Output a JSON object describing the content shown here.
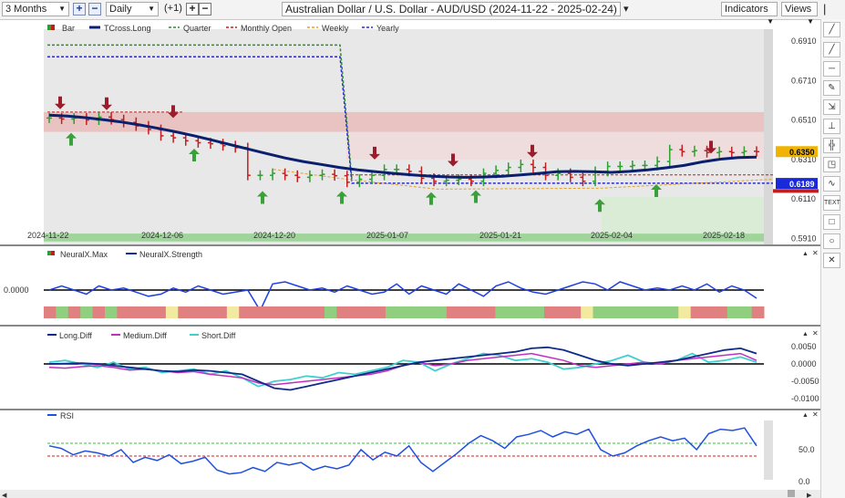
{
  "toolbar": {
    "period": "3 Months",
    "interval": "Daily",
    "offset": "(+1)",
    "symbol_title": "Australian Dollar / U.S. Dollar - AUD/USD (2024-11-22 - 2025-02-24)",
    "indicators_label": "Indicators",
    "views_label": "Views"
  },
  "colors": {
    "tcross": "#0a1f6e",
    "quarter": "#2e8b2e",
    "monthly": "#c01f1f",
    "weekly": "#e0a030",
    "yearly": "#2a2ad0",
    "up_arrow": "#3aa03a",
    "down_arrow": "#9b1c2c",
    "bar_up": "#2e9e2e",
    "bar_down": "#c01f1f",
    "panel_bg": "#e8e8e8",
    "price_tag": "#f0b400",
    "blue_tag": "#1a2ad8"
  },
  "chart_data": [
    {
      "type": "line",
      "title": "Australian Dollar / U.S. Dollar - AUD/USD (2024-11-22 - 2025-02-24)",
      "legend": [
        "Bar",
        "TCross.Long",
        "Quarter",
        "Monthly Open",
        "Weekly",
        "Yearly"
      ],
      "x_ticks": [
        "2024-11-22",
        "2024-12-06",
        "2024-12-20",
        "2025-01-07",
        "2025-01-21",
        "2025-02-04",
        "2025-02-18"
      ],
      "y_ticks": [
        "0.6910",
        "0.6710",
        "0.6510",
        "0.6310",
        "0.6110",
        "0.5910"
      ],
      "ylim": [
        0.588,
        0.697
      ],
      "price_label": "0.6350",
      "level_label": "0.6189",
      "series": [
        {
          "name": "Bar (close)",
          "values": [
            0.652,
            0.6515,
            0.652,
            0.651,
            0.6525,
            0.6512,
            0.6498,
            0.648,
            0.6462,
            0.643,
            0.642,
            0.6405,
            0.6395,
            0.639,
            0.638,
            0.637,
            0.623,
            0.623,
            0.624,
            0.623,
            0.622,
            0.623,
            0.6235,
            0.6228,
            0.6195,
            0.621,
            0.623,
            0.626,
            0.626,
            0.625,
            0.6215,
            0.62,
            0.6205,
            0.621,
            0.62,
            0.624,
            0.6255,
            0.627,
            0.6285,
            0.627,
            0.623,
            0.624,
            0.622,
            0.62,
            0.625,
            0.6275,
            0.6275,
            0.628,
            0.628,
            0.63,
            0.636,
            0.635,
            0.6355,
            0.6345,
            0.635,
            0.6345,
            0.6352,
            0.635
          ]
        },
        {
          "name": "TCross.Long",
          "values": [
            0.6535,
            0.653,
            0.6522,
            0.6512,
            0.65,
            0.6485,
            0.6468,
            0.645,
            0.643,
            0.6408,
            0.6385,
            0.6362,
            0.634,
            0.6318,
            0.63,
            0.6285,
            0.627,
            0.6258,
            0.6248,
            0.624,
            0.6232,
            0.6226,
            0.6222,
            0.622,
            0.6222,
            0.6225,
            0.6232,
            0.624,
            0.6248,
            0.625,
            0.6248,
            0.6245,
            0.625,
            0.6258,
            0.6268,
            0.628,
            0.6298,
            0.6312,
            0.632,
            0.6322
          ]
        },
        {
          "name": "Quarter",
          "values": [
            0.689,
            0.689,
            0.689,
            0.689,
            0.621,
            0.621
          ]
        },
        {
          "name": "Monthly Open",
          "values": [
            0.655,
            0.655,
            0.623,
            0.623,
            0.623
          ]
        },
        {
          "name": "Weekly",
          "values": [
            0.644,
            0.63,
            0.62,
            0.615,
            0.621
          ]
        },
        {
          "name": "Yearly",
          "values": [
            0.683,
            0.683,
            0.683,
            0.619,
            0.619
          ]
        }
      ]
    },
    {
      "type": "line",
      "legend": [
        "NeuralX.Max",
        "NeuralX.Strength"
      ],
      "y_ticks": [
        "0.0000"
      ],
      "series": [
        {
          "name": "NeuralX.Strength",
          "values": [
            0.0,
            0.1,
            0.0,
            -0.1,
            0.1,
            0.0,
            0.05,
            -0.05,
            -0.15,
            -0.1,
            0.05,
            -0.05,
            0.1,
            0.0,
            -0.1,
            -0.05,
            0.0,
            -0.5,
            0.15,
            0.2,
            0.1,
            0.0,
            0.05,
            -0.05,
            0.1,
            0.0,
            -0.1,
            -0.05,
            0.15,
            -0.1,
            0.1,
            0.0,
            -0.1,
            0.15,
            0.0,
            -0.15,
            0.1,
            0.2,
            0.05,
            -0.05,
            -0.1,
            0.0,
            0.1,
            0.2,
            0.15,
            0.0,
            0.2,
            0.1,
            0.0,
            0.05,
            0.0,
            0.1,
            0.0,
            0.15,
            -0.05,
            0.1,
            0.0,
            -0.2
          ]
        },
        {
          "name": "NeuralX.Max",
          "values": [
            "red",
            "green",
            "red",
            "green",
            "red",
            "green",
            "red",
            "red",
            "red",
            "red",
            "yellow",
            "red",
            "red",
            "red",
            "red",
            "yellow",
            "red",
            "red",
            "red",
            "red",
            "red",
            "red",
            "red",
            "green",
            "red",
            "red",
            "red",
            "red",
            "green",
            "green",
            "green",
            "green",
            "green",
            "red",
            "red",
            "red",
            "red",
            "green",
            "green",
            "green",
            "green",
            "red",
            "red",
            "red",
            "yellow",
            "green",
            "green",
            "green",
            "green",
            "green",
            "green",
            "green",
            "yellow",
            "red",
            "red",
            "red",
            "green",
            "green",
            "red"
          ]
        }
      ]
    },
    {
      "type": "line",
      "legend": [
        "Long.Diff",
        "Medium.Diff",
        "Short.Diff"
      ],
      "y_ticks": [
        "0.0050",
        "0.0000",
        "-0.0050",
        "-0.0100"
      ],
      "ylim": [
        -0.0115,
        0.0065
      ],
      "series": [
        {
          "name": "Long.Diff",
          "values": [
            0.0,
            0.0001,
            0.0002,
            0.0,
            -0.0005,
            -0.001,
            -0.0015,
            -0.002,
            -0.0022,
            -0.0018,
            -0.002,
            -0.0025,
            -0.003,
            -0.005,
            -0.007,
            -0.0075,
            -0.0065,
            -0.0055,
            -0.0045,
            -0.0035,
            -0.0025,
            -0.0015,
            -0.0005,
            0.0005,
            0.001,
            0.0015,
            0.002,
            0.0025,
            0.003,
            0.0035,
            0.0045,
            0.0048,
            0.004,
            0.0025,
            0.001,
            0.0,
            -0.0005,
            0.0,
            0.0005,
            0.001,
            0.002,
            0.003,
            0.004,
            0.0045,
            0.003
          ]
        },
        {
          "name": "Medium.Diff",
          "values": [
            -0.001,
            -0.0012,
            -0.0008,
            -0.0005,
            -0.001,
            -0.0018,
            -0.0015,
            -0.002,
            -0.0025,
            -0.0022,
            -0.003,
            -0.0035,
            -0.004,
            -0.0055,
            -0.006,
            -0.0055,
            -0.005,
            -0.0045,
            -0.004,
            -0.0035,
            -0.003,
            -0.002,
            -0.0005,
            0.0005,
            -0.0005,
            0.0,
            0.001,
            0.0015,
            0.002,
            0.0025,
            0.003,
            0.002,
            0.001,
            -0.0005,
            -0.001,
            -0.0005,
            0.0,
            0.0005,
            0.0,
            0.001,
            0.0015,
            0.002,
            0.0025,
            0.003,
            0.001
          ]
        },
        {
          "name": "Short.Diff",
          "values": [
            0.0005,
            0.001,
            0.0,
            -0.001,
            0.0005,
            -0.0015,
            -0.001,
            -0.0025,
            -0.002,
            -0.0015,
            -0.003,
            -0.002,
            -0.004,
            -0.0065,
            -0.005,
            -0.0045,
            -0.0035,
            -0.004,
            -0.0025,
            -0.003,
            -0.002,
            -0.001,
            0.001,
            0.0005,
            -0.002,
            0.0,
            0.0015,
            0.003,
            0.0025,
            0.001,
            0.0015,
            0.0005,
            -0.0015,
            -0.001,
            0.0,
            0.001,
            0.0025,
            0.0005,
            0.0,
            0.001,
            0.003,
            0.0005,
            0.001,
            0.002,
            0.0005
          ]
        }
      ]
    },
    {
      "type": "line",
      "legend": [
        "RSI"
      ],
      "y_ticks": [
        "50.0",
        "0.0"
      ],
      "ylim": [
        0,
        100
      ],
      "series": [
        {
          "name": "RSI",
          "values": [
            56,
            52,
            42,
            48,
            45,
            40,
            50,
            30,
            38,
            33,
            42,
            28,
            32,
            38,
            18,
            12,
            14,
            22,
            16,
            30,
            26,
            30,
            18,
            24,
            20,
            26,
            50,
            34,
            46,
            40,
            56,
            30,
            16,
            30,
            44,
            60,
            72,
            64,
            52,
            70,
            74,
            80,
            70,
            78,
            74,
            82,
            50,
            40,
            45,
            56,
            64,
            70,
            64,
            68,
            50,
            75,
            82,
            80,
            84,
            56
          ]
        },
        {
          "name": "Upper band",
          "values": [
            60
          ]
        },
        {
          "name": "Lower band",
          "values": [
            40
          ]
        }
      ]
    }
  ]
}
